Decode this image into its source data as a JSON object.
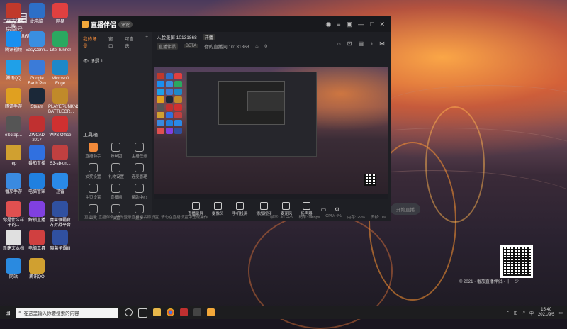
{
  "overlay": {
    "brand": "三目",
    "label": "房间号",
    "room": "10131868"
  },
  "desktop_icons": [
    {
      "label": "三国志战略版",
      "color": "#c0392b"
    },
    {
      "label": "此电脑",
      "color": "#2d6fc7"
    },
    {
      "label": "网易",
      "color": "#e04040"
    },
    {
      "label": "腾讯视频",
      "color": "#1a8ff0"
    },
    {
      "label": "EasyConn...",
      "color": "#3a8ee0"
    },
    {
      "label": "Lite Tunnel",
      "color": "#2aa860"
    },
    {
      "label": "腾讯QQ",
      "color": "#1fa0e8"
    },
    {
      "label": "Google Earth Pro",
      "color": "#3b7bd8"
    },
    {
      "label": "Microsoft Edge",
      "color": "#1e88c8"
    },
    {
      "label": "腾讯手游",
      "color": "#e0a020"
    },
    {
      "label": "Steam",
      "color": "#1b2838"
    },
    {
      "label": "PLAYERUNKNOWN'S BATTLEGR...",
      "color": "#c08a2a"
    },
    {
      "label": "eScrap...",
      "color": "#555"
    },
    {
      "label": "ZWCAD 2017",
      "color": "#c03030"
    },
    {
      "label": "WPS Office",
      "color": "#d03030"
    },
    {
      "label": "rep",
      "color": "#d0a030"
    },
    {
      "label": "番茄直播",
      "color": "#3070e0"
    },
    {
      "label": "S3-sb-on...",
      "color": "#c04040"
    },
    {
      "label": "番茄手游",
      "color": "#3a8ae0"
    },
    {
      "label": "电脑管家",
      "color": "#2080e0"
    },
    {
      "label": "迅雷",
      "color": "#2a8ae8"
    },
    {
      "label": "你是什么样子的...",
      "color": "#e05050"
    },
    {
      "label": "解锁直播",
      "color": "#8040e0"
    },
    {
      "label": "魔兽争霸官方对战平台",
      "color": "#3050a0"
    },
    {
      "label": "新建文本档",
      "color": "#e0e0e0"
    },
    {
      "label": "电脑工具",
      "color": "#d04040"
    },
    {
      "label": "魔兽争霸III",
      "color": "#3050a0"
    },
    {
      "label": "网站",
      "color": "#2a8ae0"
    },
    {
      "label": "腾讯QQ",
      "color": "#d0a030"
    }
  ],
  "window": {
    "app_name": "直播伴侣",
    "version_tag": "评论",
    "tabs": [
      "我的场景",
      "窗口",
      "可自选"
    ],
    "scene_name": "场景 1",
    "tools_title": "工具箱",
    "tools": [
      {
        "label": "直播助手",
        "highlight": true
      },
      {
        "label": "粉丝团",
        "highlight": false
      },
      {
        "label": "主播任务",
        "highlight": false
      },
      {
        "label": "抽奖设置",
        "highlight": false
      },
      {
        "label": "礼物设置",
        "highlight": false
      },
      {
        "label": "连麦管理",
        "highlight": false
      },
      {
        "label": "主页设置",
        "highlight": false
      },
      {
        "label": "直播间",
        "highlight": false
      },
      {
        "label": "帮助中心",
        "highlight": false
      },
      {
        "label": "工具",
        "highlight": false
      },
      {
        "label": "设置",
        "highlight": false
      },
      {
        "label": "更多",
        "highlight": false
      }
    ],
    "header": {
      "title": "人脸录屏 10131868",
      "badge": "开播",
      "row2_chip1": "直播伴侣",
      "row2_chip2": "BETA",
      "row2_text": "你的直播间 10131868",
      "row2_count": "0"
    },
    "controls": [
      "直播录屏",
      "摄像头",
      "手机投屏",
      "添加视频",
      "麦克风",
      "扬声器"
    ],
    "start_button": "开始直播",
    "notice": "直播间: 直播伴侣, 请先登录直播间名称设置, 请勿在直播设置中违规操作",
    "stats": [
      "帧率: 30 FPS",
      "码率: 0Kbps",
      "CPU: 4%",
      "内存: 29%",
      "丢帧: 0%"
    ]
  },
  "taskbar": {
    "search_placeholder": "在这里输入你要搜索的内容",
    "time": "15:40",
    "date": "2021/9/5",
    "tray_lang": "中"
  },
  "watermark": "© 2021 · 番茄直播伴侣 · 十一少"
}
